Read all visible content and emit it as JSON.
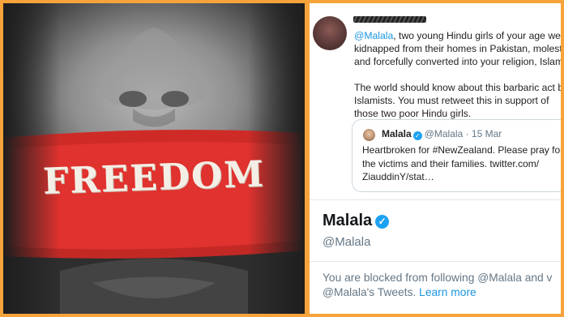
{
  "left_image": {
    "tape_text": "FREEDOM"
  },
  "tweet": {
    "mention": "@Malala",
    "lines": [
      ", two young Hindu girls of your age were",
      "kidnapped from their homes in Pakistan, moleste",
      "and forcefully converted into your religion, Islam.",
      "The world should know about this barbaric act by",
      "Islamists. You must retweet this in support of",
      "those two poor Hindu girls."
    ]
  },
  "quoted_tweet": {
    "name": "Malala",
    "handle": "@Malala",
    "separator": "·",
    "date": "15 Mar",
    "lines": [
      "Heartbroken for #NewZealand. Please pray for",
      "the victims and their families. twitter.com/",
      "ZiauddinY/stat…"
    ]
  },
  "profile": {
    "name": "Malala",
    "handle": "@Malala",
    "verified_glyph": "✓"
  },
  "blocked_notice": {
    "line1": "You are blocked from following @Malala and v",
    "line2_prefix": "@Malala's Tweets.",
    "learn_more": "Learn more"
  },
  "colors": {
    "frame": "#f7a33b",
    "tape": "#e0322e",
    "twitter_blue": "#1b95e0"
  }
}
